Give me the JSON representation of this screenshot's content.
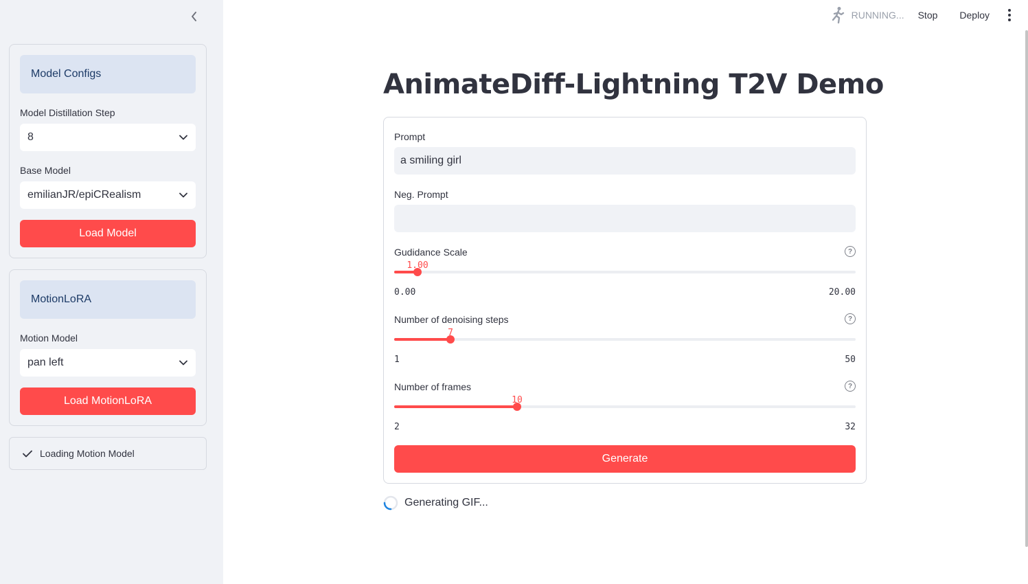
{
  "header": {
    "status": "RUNNING...",
    "stop_label": "Stop",
    "deploy_label": "Deploy"
  },
  "sidebar": {
    "model_configs": {
      "title": "Model Configs",
      "distillation_label": "Model Distillation Step",
      "distillation_value": "8",
      "base_model_label": "Base Model",
      "base_model_value": "emilianJR/epiCRealism",
      "load_button": "Load Model"
    },
    "motion_lora": {
      "title": "MotionLoRA",
      "motion_model_label": "Motion Model",
      "motion_model_value": "pan left",
      "load_button": "Load MotionLoRA"
    },
    "status_text": "Loading Motion Model"
  },
  "main": {
    "title": "AnimateDiff-Lightning T2V Demo",
    "prompt_label": "Prompt",
    "prompt_value": "a smiling girl",
    "neg_prompt_label": "Neg. Prompt",
    "neg_prompt_value": "",
    "guidance": {
      "label": "Gudidance Scale",
      "value": "1.00",
      "min": "0.00",
      "max": "20.00",
      "fraction": 0.05
    },
    "steps": {
      "label": "Number of denoising steps",
      "value": "7",
      "min": "1",
      "max": "50",
      "fraction": 0.1224
    },
    "frames": {
      "label": "Number of frames",
      "value": "10",
      "min": "2",
      "max": "32",
      "fraction": 0.2667
    },
    "generate_label": "Generate",
    "spinner_text": "Generating GIF..."
  },
  "colors": {
    "accent": "#ff4b4b",
    "sidebar_bg": "#f0f2f6",
    "card_header_bg": "#dce4f2"
  }
}
